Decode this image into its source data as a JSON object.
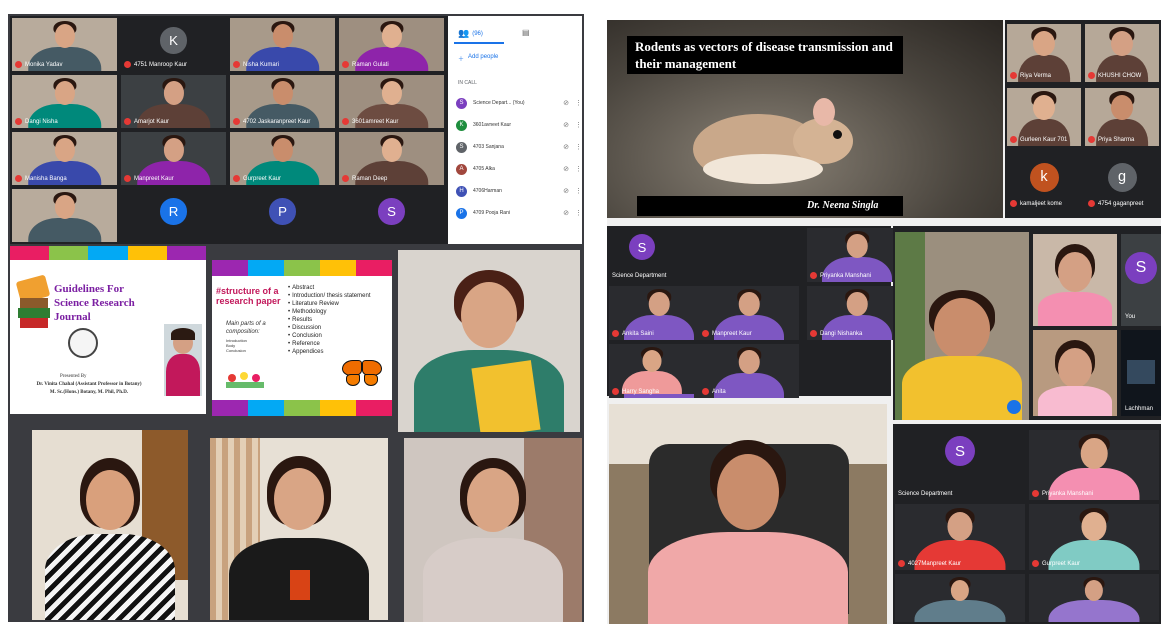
{
  "left_collage": {
    "grid_tiles": [
      {
        "name": "Monika Yadav"
      },
      {
        "name": "4751 Manroop Kaur",
        "initial": "K",
        "color": "#5f6368"
      },
      {
        "name": "Nisha Kumari"
      },
      {
        "name": "Raman Gulati"
      },
      {
        "name": "Dangi Nisha"
      },
      {
        "name": "Amarjot Kaur"
      },
      {
        "name": "4702 Jaskaranpreet Kaur"
      },
      {
        "name": "3601amreet Kaur"
      },
      {
        "name": "Manisha Banga"
      },
      {
        "name": "Manpreet Kaur"
      },
      {
        "name": "Gurpreet Kaur"
      },
      {
        "name": "Raman Deep"
      },
      {
        "name": ""
      },
      {
        "name": "",
        "initial": "R",
        "color": "#1a73e8"
      },
      {
        "name": "",
        "initial": "P",
        "color": "#3f51b5"
      },
      {
        "name": "",
        "initial": "S",
        "color": "#7b3fbf"
      }
    ],
    "people_panel": {
      "tab_label": "(96)",
      "add_label": "Add people",
      "section": "IN CALL",
      "people": [
        {
          "name": "Science Depart... (You)",
          "initial": "S",
          "color": "#7b3fbf"
        },
        {
          "name": "3601avneet Kaur",
          "initial": "K",
          "color": "#1e8e3e"
        },
        {
          "name": "4703 Sanjana",
          "initial": "S",
          "color": "#5f6368"
        },
        {
          "name": "4705 Alka",
          "initial": "A",
          "color": "#a1473d"
        },
        {
          "name": "4706Harman",
          "initial": "H",
          "color": "#3f51b5"
        },
        {
          "name": "4709 Pooja Rani",
          "initial": "P",
          "color": "#1a73e8"
        }
      ]
    },
    "slide1": {
      "title": "Guidelines For Science Research Journal",
      "presented_by": "Presented By",
      "presenter": "Dr. Vinita Chahal (Assistant Professor in Botany)",
      "degrees": "M. Sc.(Hons.) Botany, M. Phil, Ph.D."
    },
    "slide2": {
      "heading": "#structure of a research paper",
      "sub": "Main parts of a composition:",
      "parts": [
        "Introduction",
        "Body",
        "Conclusion"
      ],
      "bullets": [
        "Abstract",
        "Introduction/ thesis statement",
        "Literature Review",
        "Methodology",
        "Results",
        "Discussion",
        "Conclusion",
        "Reference",
        "Appendices"
      ]
    }
  },
  "right_collage": {
    "rodent_slide": {
      "title": "Rodents as vectors of disease transmission and their management",
      "credit": "Dr. Neena Singla"
    },
    "top_tiles": [
      {
        "name": "Riya Verma"
      },
      {
        "name": "KHUSHI CHOW"
      },
      {
        "name": "Gurleen Kaur 701"
      },
      {
        "name": "Priya Sharma"
      },
      {
        "name": "kamaljeet kome",
        "initial": "k",
        "color": "#c0521f"
      },
      {
        "name": "4754 gaganpreet",
        "initial": "g",
        "color": "#5f6368"
      }
    ],
    "mid_grid": {
      "self_initial": "S",
      "tiles": [
        {
          "name": "Science Department"
        },
        {
          "name": "Priyanka Manshani"
        },
        {
          "name": "Ankita Saini"
        },
        {
          "name": "Manpreet Kaur"
        },
        {
          "name": "Dangi Nishanka"
        },
        {
          "name": "Harry Sangha"
        },
        {
          "name": "Anita"
        }
      ]
    },
    "speaker_grid": {
      "you_initial": "S",
      "you_label": "You",
      "name": "Lachhman"
    },
    "bottom_grid": {
      "self_initial": "S",
      "tiles": [
        {
          "name": "Science Department"
        },
        {
          "name": "Priyanka Manshani"
        },
        {
          "name": "4027Manpreet Kaur"
        },
        {
          "name": "Gurpreet Kaur"
        }
      ]
    }
  }
}
